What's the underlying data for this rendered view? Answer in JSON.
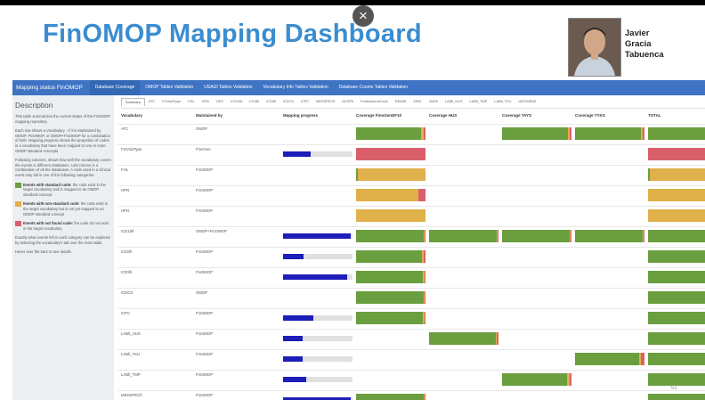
{
  "slide": {
    "title": "FinOMOP Mapping Dashboard",
    "close_glyph": "×",
    "speaker": {
      "first": "Javier",
      "middle": "Gracia",
      "last": "Tabuenca"
    },
    "page_number": "63"
  },
  "nav": {
    "brand": "Mapping status FinOMOP",
    "tabs": [
      "Database Coverage",
      "OMOP Tables Validation",
      "USAGI Tables Validation",
      "Vocabulary Info Tables Validation",
      "Database Counts Tables Validation"
    ]
  },
  "sidebar": {
    "heading": "Description",
    "paragraphs": [
      "This table summarizes the current status of the FinOMOP mapping repository.",
      "Each row shows a Vocabulary . If it is Maintained by OMOP, FinOMOP, or OMOP+FinOMOP for a combination of both. Mapping progress shows the proportion of codes in a vocabulary that have been mapped to one or more OMOP standard concepts.",
      "Following columns, shows how well the vocabulary covers the events in different databases. Last column is a combination of all the databases. A code used in a clinical event may fall in one of the following categories:"
    ],
    "legend": [
      {
        "title": "Events with standard code:",
        "text": "the code exist in the target vocabulary and is mapped to an OMOP standard concept.",
        "color": "#6a9e3f"
      },
      {
        "title": "Events with non-standard code:",
        "text": "the code exist in the target vocabulary but is not yet mapped to an OMOP standard concept",
        "color": "#e0b04a"
      },
      {
        "title": "Events with not found code:",
        "text": "the code do not exist in the target vocabulary.",
        "color": "#d9606a"
      }
    ],
    "footer": [
      "Exactly what events fell in each category can be explored by selecting the vocabulary's tab over the main table.",
      "Hover over the bars to see details."
    ]
  },
  "subtabs": [
    "Summary",
    "ATC",
    "FGVisitType",
    "FHL",
    "HPN",
    "HPO",
    "ICD10fi",
    "ICD8fi",
    "ICD9fi",
    "ICDO3",
    "ICPC",
    "MEDSPECfi",
    "NCSPfi",
    "ProfessionalCode",
    "REIMB",
    "SPAT",
    "VNRfi",
    "LABfi_HUS",
    "LABfi_TMP",
    "LABfi_TKU",
    "UNITMEDfi"
  ],
  "columns": [
    "Vocabulary",
    "Maintained by",
    "Mapping progress",
    "Coverage FinnGenDF10",
    "Coverage HUS",
    "Coverage TAYS",
    "Coverage TYKS",
    "TOTAL"
  ],
  "colors": {
    "standard": "#6a9e3f",
    "nonstandard": "#e0b04a",
    "notfound": "#d9606a",
    "progress": "#1d1db8",
    "nav": "#3f73c4",
    "title": "#3b8dd0"
  },
  "rows": [
    {
      "vocab": "ATC",
      "maintained": "OMOP",
      "progress": null,
      "cov": [
        [
          0.94,
          0.04,
          0.02
        ],
        null,
        [
          0.95,
          0.03,
          0.02
        ],
        [
          0.95,
          0.03,
          0.02
        ],
        [
          0.95,
          0.03,
          0.02
        ]
      ]
    },
    {
      "vocab": "FGVisitType",
      "maintained": "FinnGen",
      "progress": 0.4,
      "cov": [
        [
          0,
          0,
          1
        ],
        null,
        null,
        null,
        [
          0,
          0,
          1
        ]
      ]
    },
    {
      "vocab": "FHL",
      "maintained": "FinOMOP",
      "progress": null,
      "cov": [
        [
          0.03,
          0.97,
          0
        ],
        null,
        null,
        null,
        [
          0.03,
          0.97,
          0
        ]
      ]
    },
    {
      "vocab": "HPN",
      "maintained": "FinOMOP",
      "progress": null,
      "cov": [
        [
          0,
          0.9,
          0.1
        ],
        null,
        null,
        null,
        [
          0,
          0.9,
          0.1
        ]
      ]
    },
    {
      "vocab": "HPO",
      "maintained": "FinOMOP",
      "progress": null,
      "cov": [
        [
          0,
          1,
          0
        ],
        null,
        null,
        null,
        [
          0,
          1,
          0
        ]
      ]
    },
    {
      "vocab": "ICD10fi",
      "maintained": "OMOP+FinOMOP",
      "progress": 0.98,
      "cov": [
        [
          0.97,
          0.02,
          0.01
        ],
        [
          0.97,
          0.02,
          0.01
        ],
        [
          0.97,
          0.02,
          0.01
        ],
        [
          0.97,
          0.02,
          0.01
        ],
        [
          0.97,
          0.02,
          0.01
        ]
      ]
    },
    {
      "vocab": "ICD8fi",
      "maintained": "FinOMOP",
      "progress": 0.3,
      "cov": [
        [
          0.95,
          0.03,
          0.02
        ],
        null,
        null,
        null,
        [
          0.95,
          0.03,
          0.02
        ]
      ]
    },
    {
      "vocab": "ICD9fi",
      "maintained": "FinOMOP",
      "progress": 0.92,
      "cov": [
        [
          0.96,
          0.03,
          0.01
        ],
        null,
        null,
        null,
        [
          0.96,
          0.03,
          0.01
        ]
      ]
    },
    {
      "vocab": "ICDO3",
      "maintained": "OMOP",
      "progress": null,
      "cov": [
        [
          0.97,
          0.02,
          0.01
        ],
        null,
        null,
        null,
        [
          0.97,
          0.02,
          0.01
        ]
      ]
    },
    {
      "vocab": "ICPC",
      "maintained": "FinOMOP",
      "progress": 0.44,
      "cov": [
        [
          0.96,
          0.03,
          0.01
        ],
        null,
        null,
        null,
        [
          0.96,
          0.03,
          0.01
        ]
      ]
    },
    {
      "vocab": "LABfi_HUS",
      "maintained": "FinOMOP",
      "progress": 0.28,
      "cov": [
        null,
        [
          0.96,
          0.02,
          0.02
        ],
        null,
        null,
        [
          0.96,
          0.02,
          0.02
        ]
      ]
    },
    {
      "vocab": "LABfi_TKU",
      "maintained": "FinOMOP",
      "progress": 0.28,
      "cov": [
        null,
        null,
        null,
        [
          0.92,
          0.03,
          0.05
        ],
        [
          0.92,
          0.03,
          0.05
        ]
      ]
    },
    {
      "vocab": "LABfi_TMP",
      "maintained": "FinOMOP",
      "progress": 0.33,
      "cov": [
        null,
        null,
        [
          0.94,
          0.03,
          0.03
        ],
        null,
        [
          0.94,
          0.03,
          0.03
        ]
      ]
    },
    {
      "vocab": "MEDSPECfi",
      "maintained": "FinOMOP",
      "progress": 0.98,
      "cov": [
        [
          0.97,
          0.02,
          0.01
        ],
        null,
        null,
        null,
        [
          0.97,
          0.02,
          0.01
        ]
      ]
    }
  ]
}
